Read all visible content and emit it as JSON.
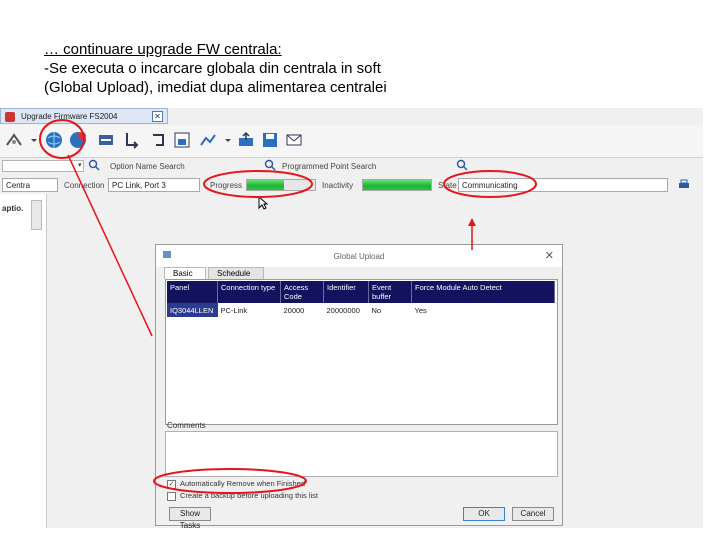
{
  "caption": {
    "line1": "… continuare  upgrade FW centrala:",
    "line2": "-Se executa o incarcare globala din centrala in soft",
    "line3": " (Global Upload),    imediat dupa alimentarea centralei"
  },
  "window": {
    "title": "Upgrade Firmware FS2004",
    "close": "✕"
  },
  "toolbar": {
    "icons": [
      "settings-tool-icon",
      "global-upload-icon",
      "global-download-icon",
      "transfer-icon",
      "download-arrow-icon",
      "repeat-icon",
      "save-device-icon",
      "chart-icon",
      "export-icon",
      "save-icon",
      "email-icon"
    ]
  },
  "search": {
    "option_label": "Option Name Search",
    "programmed_label": "Programmed Point Search"
  },
  "status": {
    "connection_value": "Centra",
    "connection_label": "Connection",
    "connection_port": "PC Link, Port 3",
    "progress_label": "Progress",
    "progress_fill": 0.55,
    "inactivity_label": "Inactivity",
    "inactivity_fill": 1.0,
    "state_label": "State",
    "state_value": "Communicating"
  },
  "left_pane": {
    "header": "aptio."
  },
  "dialog": {
    "title": "Global Upload",
    "close": "✕",
    "tabs": [
      {
        "label": "Basic"
      },
      {
        "label": "Schedule"
      }
    ],
    "columns": [
      "Panel",
      "Connection type",
      "Access Code",
      "Identifier",
      "Event buffer",
      "Force Module Auto Detect"
    ],
    "rows": [
      [
        "IQ3044LLEN",
        "PC-Link",
        "20000",
        "20000000",
        "No",
        "Yes"
      ]
    ],
    "comments_label": "Comments",
    "checkbox1": "Automatically Remove when Finished",
    "checkbox2": "Create a backup before uploading this list",
    "show_tasks": "Show Tasks",
    "ok": "OK",
    "cancel": "Cancel"
  },
  "colors": {
    "annotation": "#e8141c",
    "grid_header": "#12125e",
    "progress_green": "#1db534"
  }
}
